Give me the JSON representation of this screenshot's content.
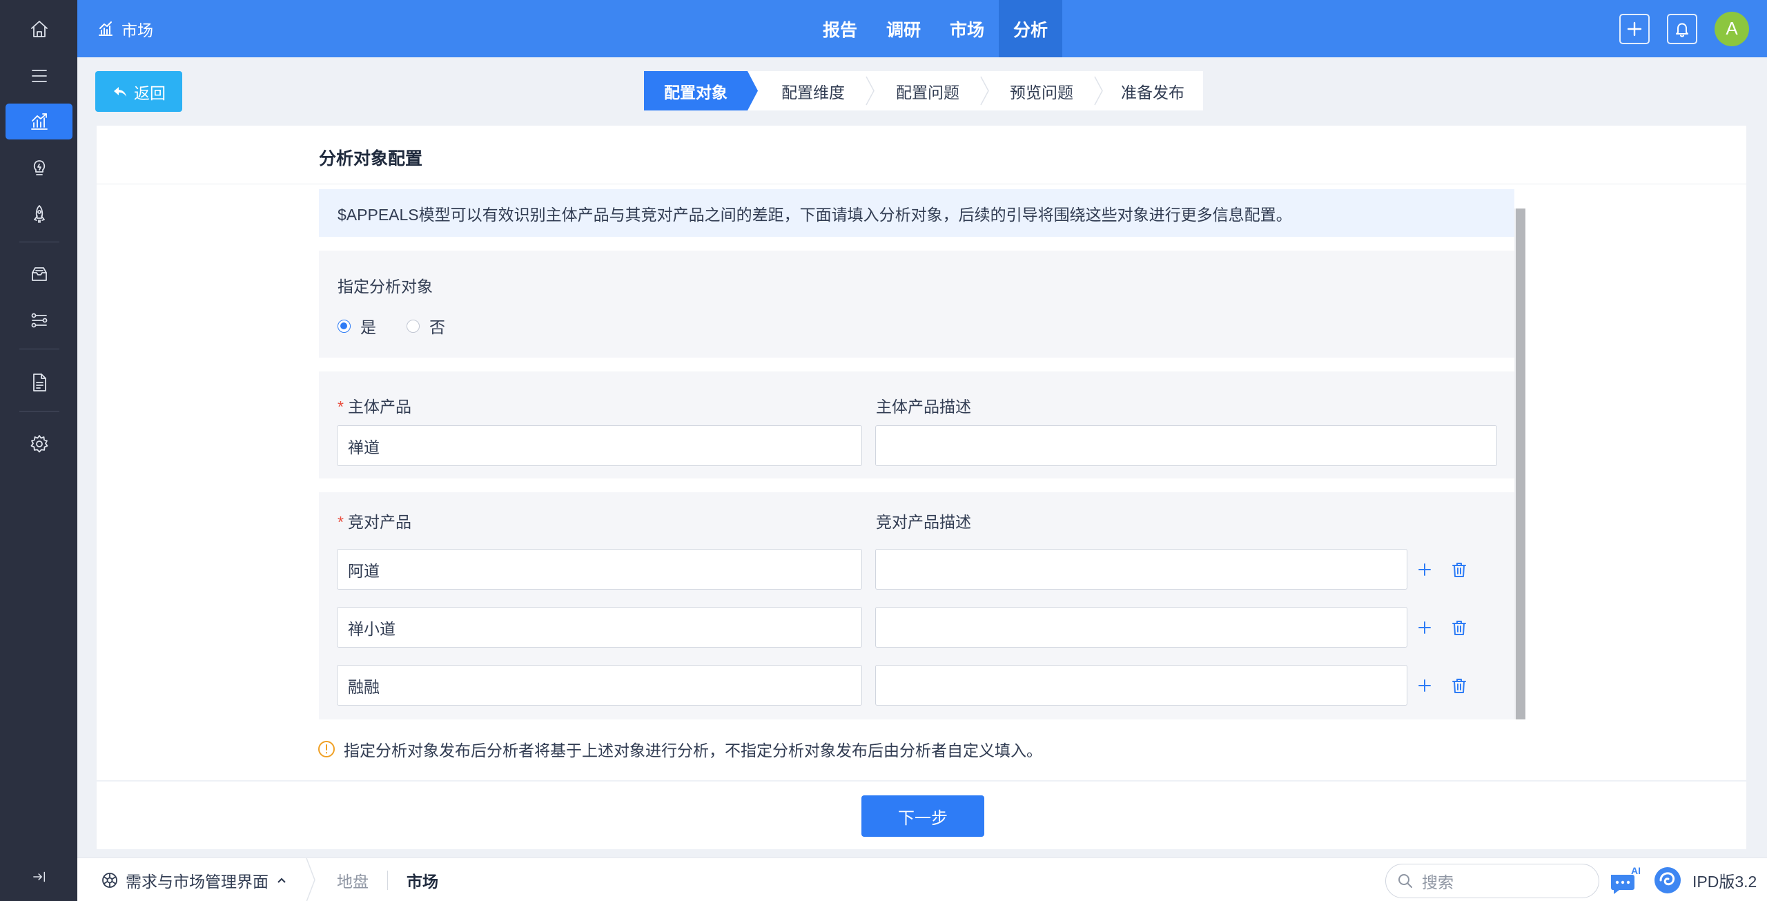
{
  "sidebar": {
    "items": [
      {
        "icon": "home-icon"
      },
      {
        "icon": "menu-icon"
      },
      {
        "icon": "market-chart-icon",
        "active": true
      },
      {
        "icon": "idea-bulb-icon"
      },
      {
        "icon": "rocket-icon"
      },
      {
        "icon": "inbox-icon"
      },
      {
        "icon": "workflow-icon"
      },
      {
        "icon": "document-icon"
      },
      {
        "icon": "settings-icon"
      },
      {
        "icon": "collapse-sidebar-icon"
      }
    ]
  },
  "topbar": {
    "app_title": "市场",
    "nav": [
      {
        "label": "报告"
      },
      {
        "label": "调研"
      },
      {
        "label": "市场"
      },
      {
        "label": "分析",
        "active": true
      }
    ],
    "avatar_letter": "A",
    "accent": "#3d86f2"
  },
  "back_label": "返回",
  "steps": [
    {
      "label": "配置对象",
      "active": true
    },
    {
      "label": "配置维度"
    },
    {
      "label": "配置问题"
    },
    {
      "label": "预览问题"
    },
    {
      "label": "准备发布"
    }
  ],
  "form": {
    "title": "分析对象配置",
    "info": "$APPEALS模型可以有效识别主体产品与其竞对产品之间的差距，下面请填入分析对象，后续的引导将围绕这些对象进行更多信息配置。",
    "specify": {
      "label": "指定分析对象",
      "options": [
        {
          "label": "是",
          "checked": true
        },
        {
          "label": "否",
          "checked": false
        }
      ]
    },
    "main_product": {
      "label": "主体产品",
      "desc_label": "主体产品描述",
      "value": "禅道",
      "desc_value": ""
    },
    "competitors": {
      "label": "竞对产品",
      "desc_label": "竞对产品描述",
      "rows": [
        {
          "value": "阿道",
          "desc": ""
        },
        {
          "value": "禅小道",
          "desc": ""
        },
        {
          "value": "融融",
          "desc": ""
        }
      ]
    },
    "hint": "指定分析对象发布后分析者将基于上述对象进行分析，不指定分析对象发布后由分析者自定义填入。",
    "next_label": "下一步"
  },
  "bottombar": {
    "app_switch": "需求与市场管理界面",
    "crumbs": [
      {
        "label": "地盘"
      },
      {
        "label": "市场",
        "active": true
      }
    ],
    "search_placeholder": "搜索",
    "ai_badge": "AI",
    "version": "IPD版3.2"
  }
}
